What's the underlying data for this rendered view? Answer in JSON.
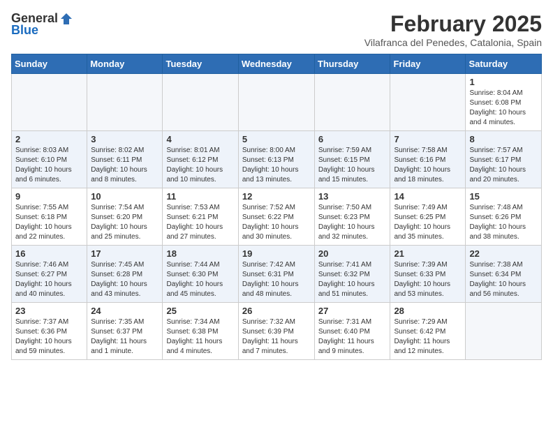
{
  "header": {
    "logo_general": "General",
    "logo_blue": "Blue",
    "month_year": "February 2025",
    "location": "Vilafranca del Penedes, Catalonia, Spain"
  },
  "weekdays": [
    "Sunday",
    "Monday",
    "Tuesday",
    "Wednesday",
    "Thursday",
    "Friday",
    "Saturday"
  ],
  "weeks": [
    [
      {
        "day": "",
        "info": ""
      },
      {
        "day": "",
        "info": ""
      },
      {
        "day": "",
        "info": ""
      },
      {
        "day": "",
        "info": ""
      },
      {
        "day": "",
        "info": ""
      },
      {
        "day": "",
        "info": ""
      },
      {
        "day": "1",
        "info": "Sunrise: 8:04 AM\nSunset: 6:08 PM\nDaylight: 10 hours\nand 4 minutes."
      }
    ],
    [
      {
        "day": "2",
        "info": "Sunrise: 8:03 AM\nSunset: 6:10 PM\nDaylight: 10 hours\nand 6 minutes."
      },
      {
        "day": "3",
        "info": "Sunrise: 8:02 AM\nSunset: 6:11 PM\nDaylight: 10 hours\nand 8 minutes."
      },
      {
        "day": "4",
        "info": "Sunrise: 8:01 AM\nSunset: 6:12 PM\nDaylight: 10 hours\nand 10 minutes."
      },
      {
        "day": "5",
        "info": "Sunrise: 8:00 AM\nSunset: 6:13 PM\nDaylight: 10 hours\nand 13 minutes."
      },
      {
        "day": "6",
        "info": "Sunrise: 7:59 AM\nSunset: 6:15 PM\nDaylight: 10 hours\nand 15 minutes."
      },
      {
        "day": "7",
        "info": "Sunrise: 7:58 AM\nSunset: 6:16 PM\nDaylight: 10 hours\nand 18 minutes."
      },
      {
        "day": "8",
        "info": "Sunrise: 7:57 AM\nSunset: 6:17 PM\nDaylight: 10 hours\nand 20 minutes."
      }
    ],
    [
      {
        "day": "9",
        "info": "Sunrise: 7:55 AM\nSunset: 6:18 PM\nDaylight: 10 hours\nand 22 minutes."
      },
      {
        "day": "10",
        "info": "Sunrise: 7:54 AM\nSunset: 6:20 PM\nDaylight: 10 hours\nand 25 minutes."
      },
      {
        "day": "11",
        "info": "Sunrise: 7:53 AM\nSunset: 6:21 PM\nDaylight: 10 hours\nand 27 minutes."
      },
      {
        "day": "12",
        "info": "Sunrise: 7:52 AM\nSunset: 6:22 PM\nDaylight: 10 hours\nand 30 minutes."
      },
      {
        "day": "13",
        "info": "Sunrise: 7:50 AM\nSunset: 6:23 PM\nDaylight: 10 hours\nand 32 minutes."
      },
      {
        "day": "14",
        "info": "Sunrise: 7:49 AM\nSunset: 6:25 PM\nDaylight: 10 hours\nand 35 minutes."
      },
      {
        "day": "15",
        "info": "Sunrise: 7:48 AM\nSunset: 6:26 PM\nDaylight: 10 hours\nand 38 minutes."
      }
    ],
    [
      {
        "day": "16",
        "info": "Sunrise: 7:46 AM\nSunset: 6:27 PM\nDaylight: 10 hours\nand 40 minutes."
      },
      {
        "day": "17",
        "info": "Sunrise: 7:45 AM\nSunset: 6:28 PM\nDaylight: 10 hours\nand 43 minutes."
      },
      {
        "day": "18",
        "info": "Sunrise: 7:44 AM\nSunset: 6:30 PM\nDaylight: 10 hours\nand 45 minutes."
      },
      {
        "day": "19",
        "info": "Sunrise: 7:42 AM\nSunset: 6:31 PM\nDaylight: 10 hours\nand 48 minutes."
      },
      {
        "day": "20",
        "info": "Sunrise: 7:41 AM\nSunset: 6:32 PM\nDaylight: 10 hours\nand 51 minutes."
      },
      {
        "day": "21",
        "info": "Sunrise: 7:39 AM\nSunset: 6:33 PM\nDaylight: 10 hours\nand 53 minutes."
      },
      {
        "day": "22",
        "info": "Sunrise: 7:38 AM\nSunset: 6:34 PM\nDaylight: 10 hours\nand 56 minutes."
      }
    ],
    [
      {
        "day": "23",
        "info": "Sunrise: 7:37 AM\nSunset: 6:36 PM\nDaylight: 10 hours\nand 59 minutes."
      },
      {
        "day": "24",
        "info": "Sunrise: 7:35 AM\nSunset: 6:37 PM\nDaylight: 11 hours\nand 1 minute."
      },
      {
        "day": "25",
        "info": "Sunrise: 7:34 AM\nSunset: 6:38 PM\nDaylight: 11 hours\nand 4 minutes."
      },
      {
        "day": "26",
        "info": "Sunrise: 7:32 AM\nSunset: 6:39 PM\nDaylight: 11 hours\nand 7 minutes."
      },
      {
        "day": "27",
        "info": "Sunrise: 7:31 AM\nSunset: 6:40 PM\nDaylight: 11 hours\nand 9 minutes."
      },
      {
        "day": "28",
        "info": "Sunrise: 7:29 AM\nSunset: 6:42 PM\nDaylight: 11 hours\nand 12 minutes."
      },
      {
        "day": "",
        "info": ""
      }
    ]
  ]
}
